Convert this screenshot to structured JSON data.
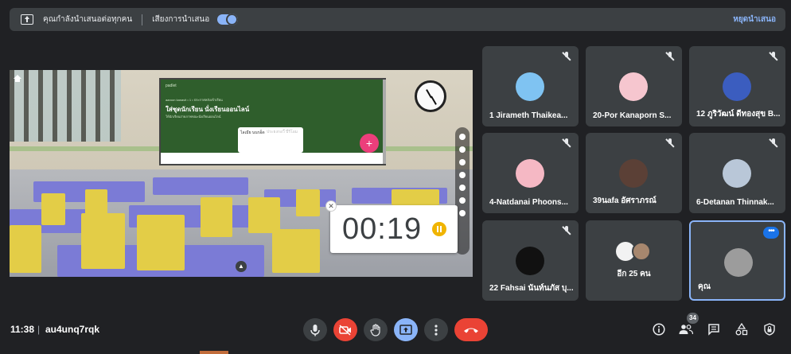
{
  "presenting_bar": {
    "message": "คุณกำลังนำเสนอต่อทุกคน",
    "audio_label": "เสียงการนำเสนอ",
    "audio_enabled": true,
    "stop_label": "หยุดนำเสนอ"
  },
  "shared_screen": {
    "padlet": {
      "brand": "padlet",
      "crumbs": "aaroon kanavit • 1 • ประกาศหลังเข้าเรียน",
      "title": "ใส่ชุดนักเรียน นั่งเรียนออนไลน์",
      "subtitle": "ให้นักเรียนถ่ายภาพขณะนั่งเรียนออนไลน์",
      "card_label": "ไลเมีย นนรอ็ด",
      "card_hint": "ประยงกอวี้ ปี่รีโอม",
      "add_label": "+"
    },
    "timer": {
      "value": "00:19"
    }
  },
  "participants": [
    {
      "name": "1 Jirameth Thaikea...",
      "muted": true,
      "avatar_color": "#7fc3f2"
    },
    {
      "name": "20-Por Kanaporn S...",
      "muted": true,
      "avatar_color": "#f6c6cf"
    },
    {
      "name": "12 ภูริวัฒน์ ดีทองสุข B...",
      "muted": true,
      "avatar_color": "#3b5dbf"
    },
    {
      "name": "4-Natdanai Phoons...",
      "muted": true,
      "avatar_color": "#f5b8c4"
    },
    {
      "name": "39นafa อัศราภรณ์",
      "muted": true,
      "avatar_color": "#5b4036"
    },
    {
      "name": "6-Detanan Thinnak...",
      "muted": true,
      "avatar_color": "#b9c7d8"
    },
    {
      "name": "22 Fahsai นันท์นภัส บุ...",
      "muted": true,
      "avatar_color": "#111111"
    }
  ],
  "others_tile": {
    "label": "อีก 25 คน"
  },
  "self_tile": {
    "name": "คุณ",
    "avatar_color": "#9c9c9c",
    "more_label": "•••"
  },
  "bottom_bar": {
    "time": "11:38",
    "separator": "|",
    "meeting_code": "au4unq7rqk",
    "participant_count": "34"
  },
  "colors": {
    "background": "#202124",
    "tile": "#3c4043",
    "accent": "#8ab4f8",
    "danger": "#ea4335"
  }
}
